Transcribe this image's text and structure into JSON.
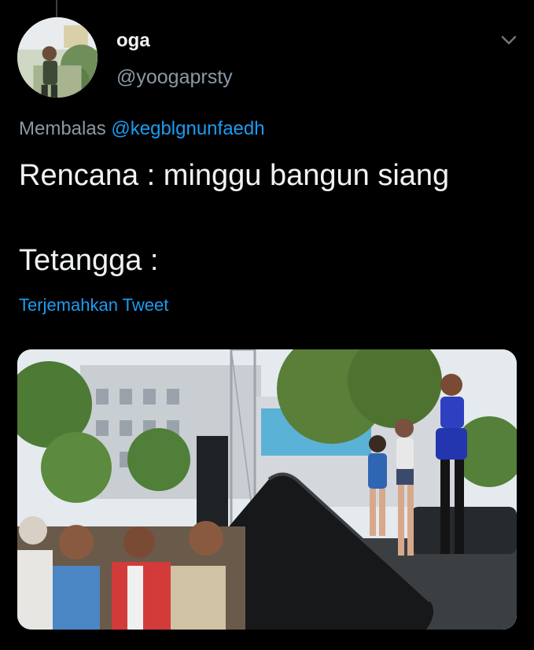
{
  "tweet": {
    "display_name": "oga",
    "handle": "@yoogaprsty",
    "reply_prefix": "Membalas",
    "reply_mention": "@kegblgnunfaedh",
    "text": "Rencana : minggu bangun siang\n\nTetangga :",
    "translate_label": "Terjemahkan Tweet"
  },
  "icons": {
    "more": "chevron-down-icon"
  },
  "colors": {
    "background": "#000000",
    "link": "#1d9bf0",
    "secondary_text": "#8b98a5"
  }
}
